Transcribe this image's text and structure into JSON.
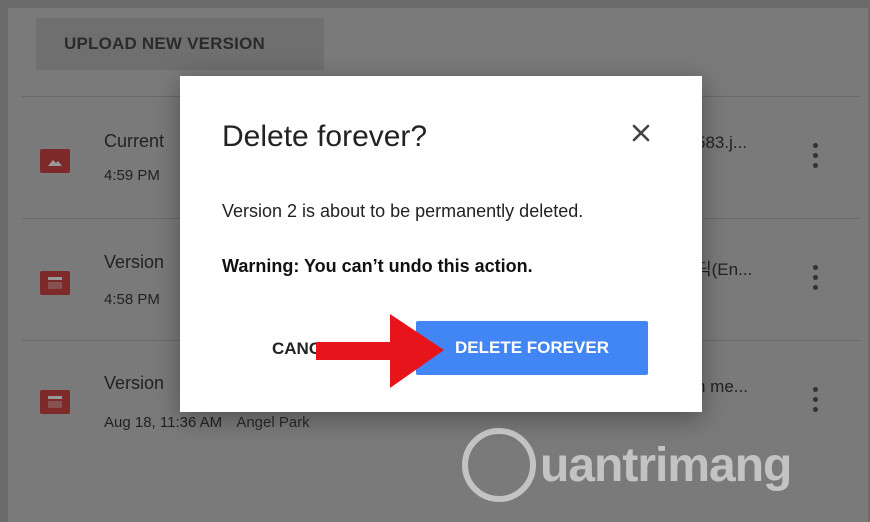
{
  "toolbar": {
    "upload_label": "UPLOAD NEW VERSION"
  },
  "versions": [
    {
      "title": "Current",
      "time": "4:59 PM",
      "file": "583.j...",
      "icon": "image-icon"
    },
    {
      "title": "Version",
      "time": "4:58 PM",
      "file": "딕(En...",
      "icon": "video-icon"
    },
    {
      "title": "Version",
      "time": "Aug 18, 11:36 AM",
      "author": "Angel Park",
      "file": "n me...",
      "icon": "video-icon"
    }
  ],
  "dialog": {
    "title": "Delete forever?",
    "message": "Version 2 is about to be permanently deleted.",
    "warning": "Warning: You can’t undo this action.",
    "cancel_label": "CANCEL",
    "confirm_label": "DELETE FOREVER",
    "close_icon": "close-icon"
  },
  "watermark": {
    "text": "uantrimang"
  },
  "colors": {
    "accent": "#4285f4",
    "arrow": "#e8141b",
    "file_icon": "#7e2a2a"
  }
}
